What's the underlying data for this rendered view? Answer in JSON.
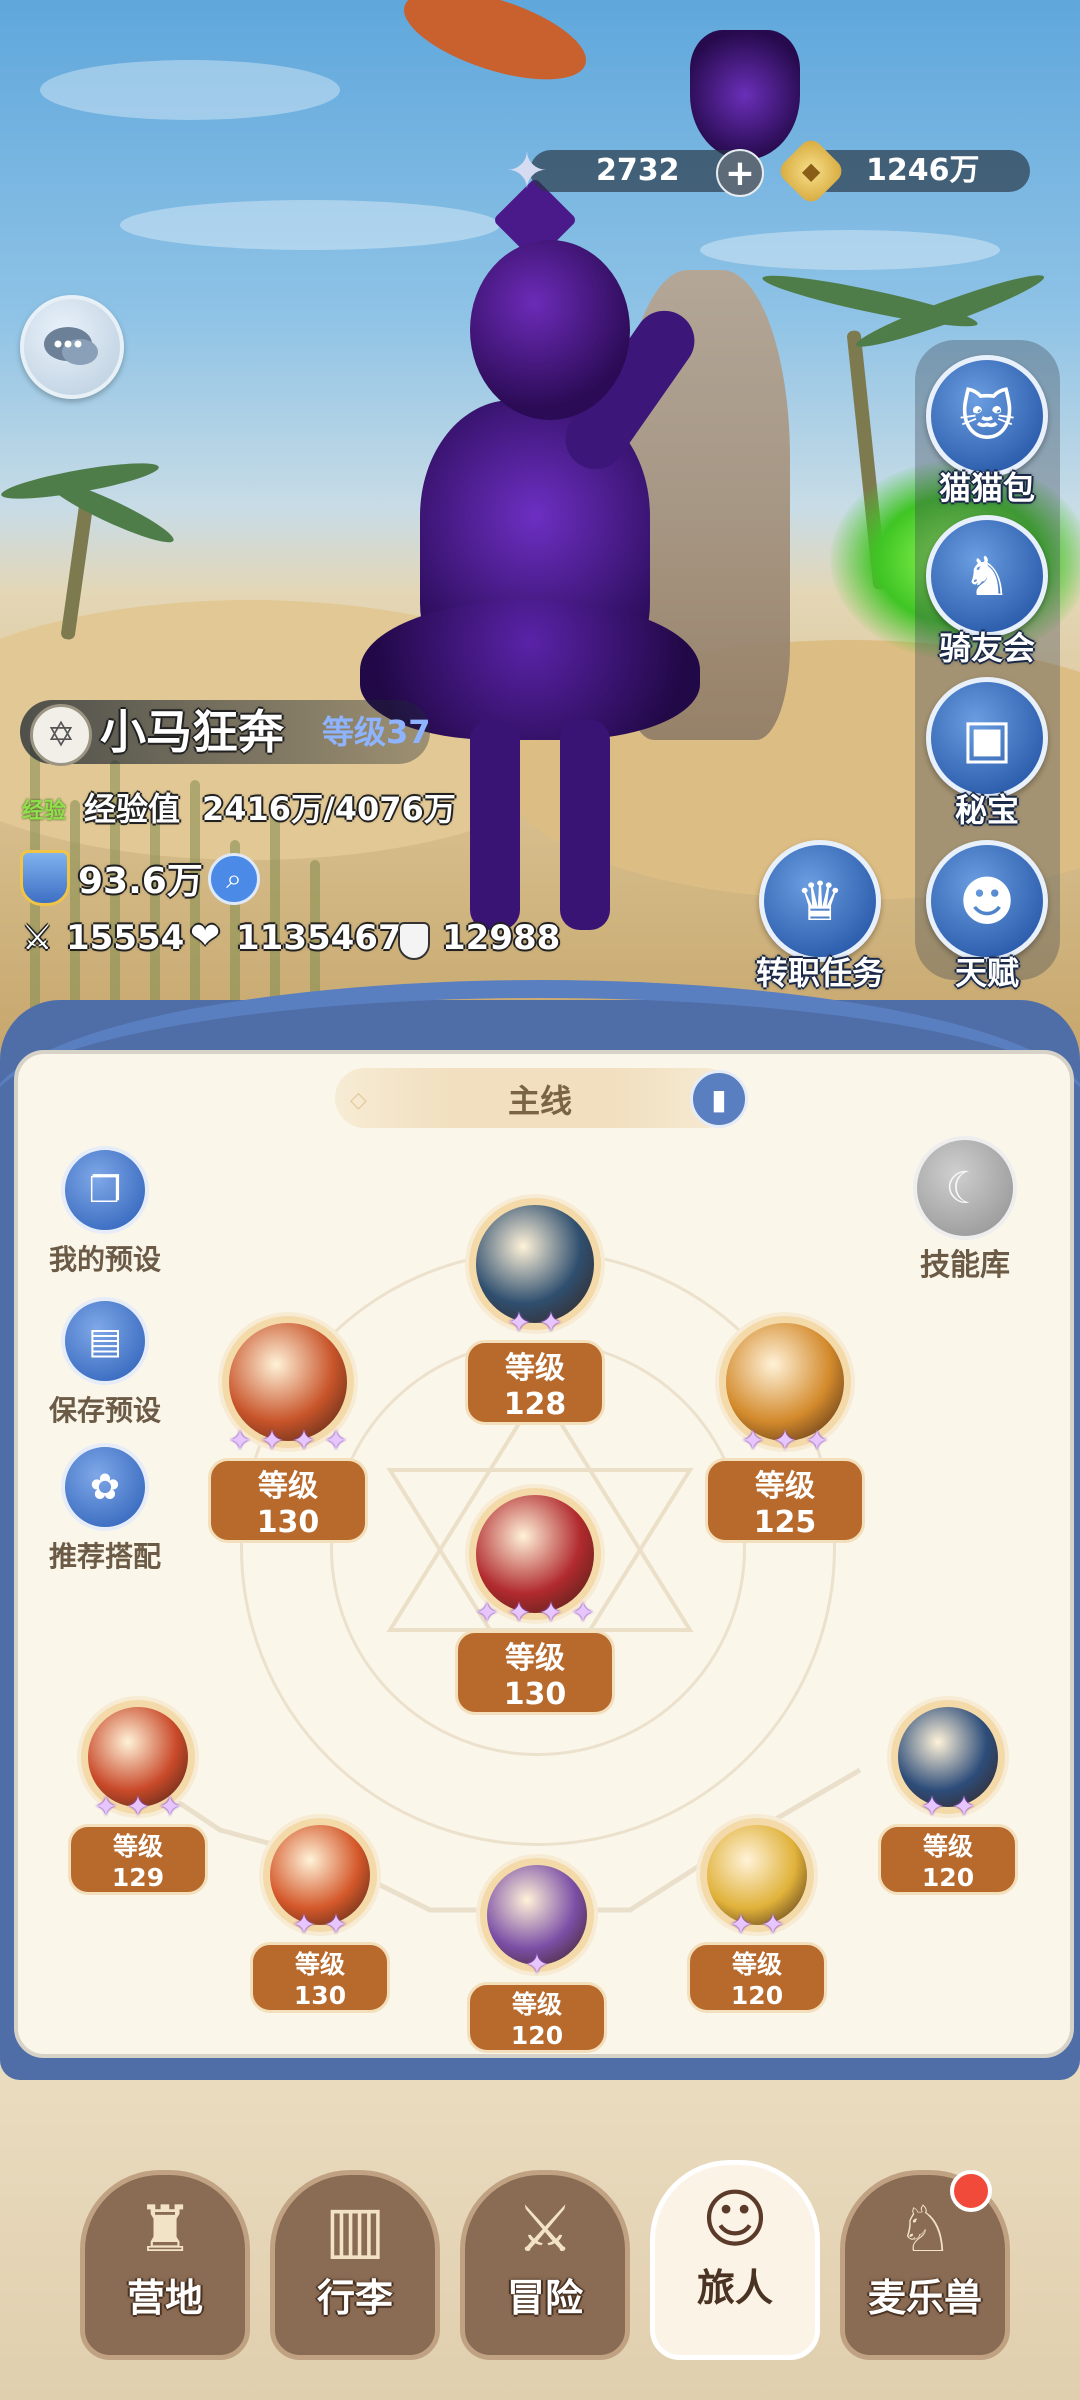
{
  "currency": {
    "stars": "2732",
    "stars_icon": "star-crystal-icon",
    "add_icon": "plus-icon",
    "gold": "1246万",
    "gold_icon": "gold-coin-icon"
  },
  "chat": {
    "icon": "chat-bubble-icon"
  },
  "side_menu": [
    {
      "label": "猫猫包",
      "icon": "cat-bag-icon"
    },
    {
      "label": "骑友会",
      "icon": "horse-icon"
    },
    {
      "label": "秘宝",
      "icon": "treasure-chest-icon"
    },
    {
      "label": "天赋",
      "icon": "brain-head-icon"
    }
  ],
  "job_quest": {
    "label": "转职任务",
    "icon": "crown-badge-icon"
  },
  "player": {
    "name": "小马狂奔",
    "level": "等级37",
    "exp_tag": "经验",
    "exp_label": "经验值",
    "exp_value": "2416万/4076万",
    "power": "93.6万",
    "attack": "15554",
    "hp": "1135467",
    "defense": "12988"
  },
  "panel": {
    "tab_title": "主线",
    "skill_library": "技能库",
    "left_buttons": [
      {
        "label": "我的预设",
        "icon": "cards-icon"
      },
      {
        "label": "保存预设",
        "icon": "save-icon"
      },
      {
        "label": "推荐搭配",
        "icon": "recommend-icon"
      }
    ]
  },
  "skills": [
    {
      "level": "等级128",
      "stars": 2,
      "icon": "ice-shield-skill-icon",
      "color": "#2f4f6f"
    },
    {
      "level": "等级130",
      "stars": 4,
      "icon": "fire-slash-skill-icon",
      "color": "#c8542a"
    },
    {
      "level": "等级125",
      "stars": 3,
      "icon": "flame-burst-skill-icon",
      "color": "#d38a2c"
    },
    {
      "level": "等级130",
      "stars": 4,
      "icon": "red-explosion-skill-icon",
      "color": "#b12a2e"
    },
    {
      "level": "等级129",
      "stars": 3,
      "icon": "fire-claw-skill-icon",
      "color": "#c94a2a"
    },
    {
      "level": "等级130",
      "stars": 2,
      "icon": "lightning-fire-skill-icon",
      "color": "#d4582a"
    },
    {
      "level": "等级120",
      "stars": 1,
      "icon": "purple-orb-skill-icon",
      "color": "#7b4fa6"
    },
    {
      "level": "等级120",
      "stars": 2,
      "icon": "golden-swirl-skill-icon",
      "color": "#e0b23a"
    },
    {
      "level": "等级120",
      "stars": 2,
      "icon": "bunny-spirit-skill-icon",
      "color": "#2d4d7a"
    }
  ],
  "nav": [
    {
      "label": "营地",
      "icon": "castle-icon"
    },
    {
      "label": "行李",
      "icon": "backpack-icon"
    },
    {
      "label": "冒险",
      "icon": "crossed-swords-icon"
    },
    {
      "label": "旅人",
      "icon": "traveler-avatar-icon"
    },
    {
      "label": "麦乐兽",
      "icon": "fox-pet-icon"
    }
  ]
}
